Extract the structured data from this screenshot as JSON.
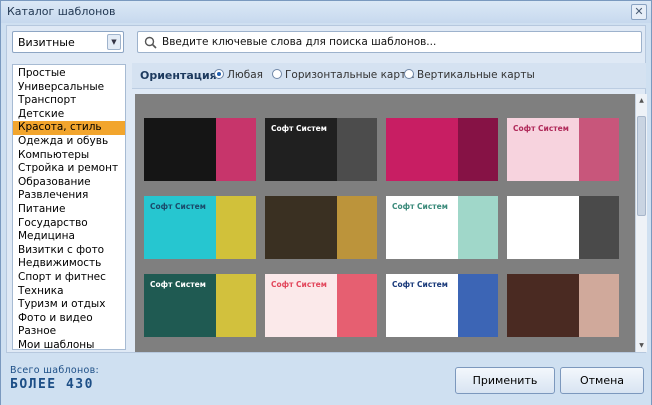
{
  "window": {
    "title": "Каталог шаблонов",
    "close_glyph": "✕"
  },
  "category_select": {
    "value": "Визитные",
    "arrow_glyph": "▼"
  },
  "categories": [
    "Простые",
    "Универсальные",
    "Транспорт",
    "Детские",
    "Красота, стиль",
    "Одежда и обувь",
    "Компьютеры",
    "Стройка и ремонт",
    "Образование",
    "Развлечения",
    "Питание",
    "Государство",
    "Медицина",
    "Визитки с фото",
    "Недвижимость",
    "Спорт и фитнес",
    "Техника",
    "Туризм и отдых",
    "Фото и видео",
    "Разное",
    "Мои шаблоны"
  ],
  "selected_category_index": 4,
  "search": {
    "placeholder": "Введите ключевые слова для поиска шаблонов..."
  },
  "orientation": {
    "label": "Ориентация:",
    "options": [
      "Любая",
      "Горизонтальные карты",
      "Вертикальные карты"
    ],
    "selected_index": 0
  },
  "template_cards": [
    {
      "name": "",
      "bg": "#151515",
      "accent": "#e63b7a",
      "text_color": "#ffffff"
    },
    {
      "name": "Софт Систем",
      "bg": "#202020",
      "accent": "#555555",
      "text_color": "#ffffff"
    },
    {
      "name": "",
      "bg": "#c81e63",
      "accent": "#7a1040",
      "text_color": "#ffffff"
    },
    {
      "name": "Софт Систем",
      "bg": "#f7d3de",
      "accent": "#c0406a",
      "text_color": "#b02a5a"
    },
    {
      "name": "Софт Систем",
      "bg": "#26c6d0",
      "accent": "#f0c020",
      "text_color": "#1a4a6a"
    },
    {
      "name": "",
      "bg": "#3a3022",
      "accent": "#d4a640",
      "text_color": "#ffffff"
    },
    {
      "name": "Софт Систем",
      "bg": "#ffffff",
      "accent": "#8fd0c0",
      "text_color": "#3a8a7a"
    },
    {
      "name": "",
      "bg": "#ffffff",
      "accent": "#2a2a2a",
      "text_color": "#333333"
    },
    {
      "name": "Софт Систем",
      "bg": "#1f5a52",
      "accent": "#f2d33a",
      "text_color": "#ffffff"
    },
    {
      "name": "Софт Систем",
      "bg": "#fbe9ea",
      "accent": "#e2475c",
      "text_color": "#e2475c"
    },
    {
      "name": "Софт Систем",
      "bg": "#ffffff",
      "accent": "#1a4aa8",
      "text_color": "#1a3a7a"
    },
    {
      "name": "",
      "bg": "#4a2a22",
      "accent": "#e8c0b0",
      "text_color": "#ffffff"
    }
  ],
  "footer": {
    "total_label": "Всего шаблонов:",
    "total_value": "БОЛЕЕ 430",
    "apply_label": "Применить",
    "cancel_label": "Отмена"
  },
  "scroll": {
    "up_glyph": "▲",
    "down_glyph": "▼"
  }
}
